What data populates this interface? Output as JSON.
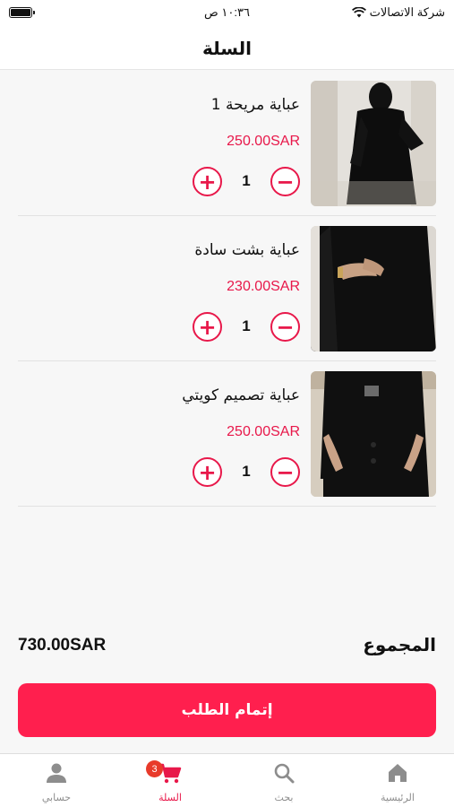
{
  "status_bar": {
    "carrier": "شركة الاتصالات",
    "time": "١٠:٣٦ ص",
    "icons": [
      "wifi-icon",
      "battery-icon"
    ]
  },
  "header": {
    "title": "السلة"
  },
  "cart": {
    "items": [
      {
        "title": "عباية مريحة 1",
        "price": "250.00SAR",
        "quantity": "1"
      },
      {
        "title": "عباية بشت سادة",
        "price": "230.00SAR",
        "quantity": "1"
      },
      {
        "title": "عباية تصميم كويتي",
        "price": "250.00SAR",
        "quantity": "1"
      }
    ],
    "qty_plus_symbol": "+",
    "qty_minus_symbol": "−"
  },
  "totals": {
    "label": "المجموع",
    "amount": "730.00SAR"
  },
  "checkout": {
    "label": "إتمام الطلب"
  },
  "tabbar": {
    "tabs": [
      {
        "label": "الرئيسية",
        "icon": "home-icon"
      },
      {
        "label": "بحث",
        "icon": "search-icon"
      },
      {
        "label": "السلة",
        "icon": "cart-icon",
        "badge": "3",
        "active": true
      },
      {
        "label": "حسابي",
        "icon": "user-icon"
      }
    ]
  },
  "colors": {
    "accent": "#ff1f4e",
    "price": "#e8184a",
    "badge": "#e83a2a"
  }
}
